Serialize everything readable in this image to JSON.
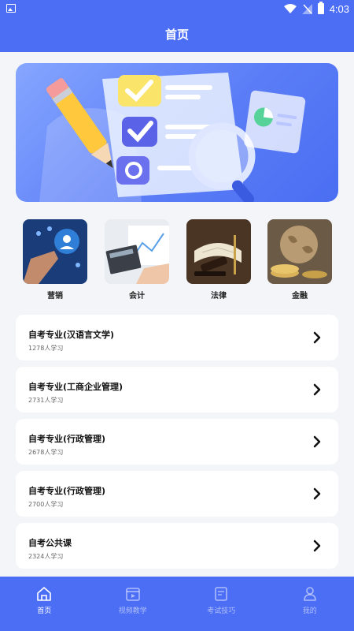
{
  "status_bar": {
    "time": "4:03"
  },
  "header": {
    "title": "首页"
  },
  "categories": [
    {
      "label": "营销",
      "icon": "marketing-image"
    },
    {
      "label": "会计",
      "icon": "accounting-image"
    },
    {
      "label": "法律",
      "icon": "law-image"
    },
    {
      "label": "金融",
      "icon": "finance-image"
    }
  ],
  "courses": [
    {
      "title": "自考专业(汉语言文学)",
      "count": "1278人学习"
    },
    {
      "title": "自考专业(工商企业管理)",
      "count": "2731人学习"
    },
    {
      "title": "自考专业(行政管理)",
      "count": "2678人学习"
    },
    {
      "title": "自考专业(行政管理)",
      "count": "2700人学习"
    },
    {
      "title": "自考公共课",
      "count": "2324人学习"
    }
  ],
  "tabs": [
    {
      "label": "首页",
      "icon": "home-icon",
      "active": true
    },
    {
      "label": "视频教学",
      "icon": "video-icon",
      "active": false
    },
    {
      "label": "考试技巧",
      "icon": "exam-icon",
      "active": false
    },
    {
      "label": "我的",
      "icon": "profile-icon",
      "active": false
    }
  ],
  "colors": {
    "primary": "#4c6ef5",
    "background": "#f4f5f9",
    "card": "#ffffff"
  }
}
